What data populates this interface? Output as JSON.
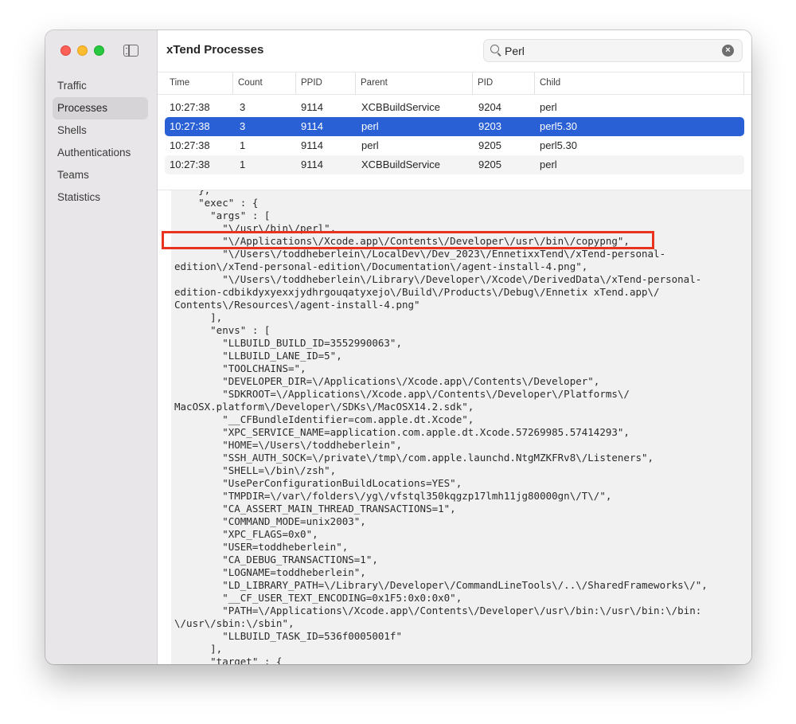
{
  "window": {
    "title": "xTend Processes"
  },
  "sidebar": {
    "items": [
      {
        "label": "Traffic",
        "selected": false
      },
      {
        "label": "Processes",
        "selected": true
      },
      {
        "label": "Shells",
        "selected": false
      },
      {
        "label": "Authentications",
        "selected": false
      },
      {
        "label": "Teams",
        "selected": false
      },
      {
        "label": "Statistics",
        "selected": false
      }
    ]
  },
  "search": {
    "value": "Perl",
    "placeholder": "Search"
  },
  "table": {
    "columns": [
      "Time",
      "Count",
      "PPID",
      "Parent",
      "PID",
      "Child"
    ],
    "rows": [
      {
        "time": "10:27:38",
        "count": "3",
        "ppid": "9114",
        "parent": "XCBBuildService",
        "pid": "9204",
        "child": "perl"
      },
      {
        "time": "10:27:38",
        "count": "3",
        "ppid": "9114",
        "parent": "perl",
        "pid": "9203",
        "child": "perl5.30"
      },
      {
        "time": "10:27:38",
        "count": "1",
        "ppid": "9114",
        "parent": "perl",
        "pid": "9205",
        "child": "perl5.30"
      },
      {
        "time": "10:27:38",
        "count": "1",
        "ppid": "9114",
        "parent": "XCBBuildService",
        "pid": "9205",
        "child": "perl"
      }
    ],
    "selected_row": 1
  },
  "detail": {
    "lines": [
      "    },",
      "    \"exec\" : {",
      "      \"args\" : [",
      "        \"\\/usr\\/bin\\/perl\",",
      "        \"\\/Applications\\/Xcode.app\\/Contents\\/Developer\\/usr\\/bin\\/copypng\",",
      "        \"\\/Users\\/toddheberlein\\/LocalDev\\/Dev_2023\\/EnnetixxTend\\/xTend-personal-",
      "edition\\/xTend-personal-edition\\/Documentation\\/agent-install-4.png\",",
      "        \"\\/Users\\/toddheberlein\\/Library\\/Developer\\/Xcode\\/DerivedData\\/xTend-personal-",
      "edition-cdbikdyxyexxjydhrgouqatyxejo\\/Build\\/Products\\/Debug\\/Ennetix xTend.app\\/",
      "Contents\\/Resources\\/agent-install-4.png\"",
      "      ],",
      "      \"envs\" : [",
      "        \"LLBUILD_BUILD_ID=3552990063\",",
      "        \"LLBUILD_LANE_ID=5\",",
      "        \"TOOLCHAINS=\",",
      "        \"DEVELOPER_DIR=\\/Applications\\/Xcode.app\\/Contents\\/Developer\",",
      "        \"SDKROOT=\\/Applications\\/Xcode.app\\/Contents\\/Developer\\/Platforms\\/",
      "MacOSX.platform\\/Developer\\/SDKs\\/MacOSX14.2.sdk\",",
      "        \"__CFBundleIdentifier=com.apple.dt.Xcode\",",
      "        \"XPC_SERVICE_NAME=application.com.apple.dt.Xcode.57269985.57414293\",",
      "        \"HOME=\\/Users\\/toddheberlein\",",
      "        \"SSH_AUTH_SOCK=\\/private\\/tmp\\/com.apple.launchd.NtgMZKFRv8\\/Listeners\",",
      "        \"SHELL=\\/bin\\/zsh\",",
      "        \"UsePerConfigurationBuildLocations=YES\",",
      "        \"TMPDIR=\\/var\\/folders\\/yg\\/vfstql350kqgzp17lmh11jg80000gn\\/T\\/\",",
      "        \"CA_ASSERT_MAIN_THREAD_TRANSACTIONS=1\",",
      "        \"COMMAND_MODE=unix2003\",",
      "        \"XPC_FLAGS=0x0\",",
      "        \"USER=toddheberlein\",",
      "        \"CA_DEBUG_TRANSACTIONS=1\",",
      "        \"LOGNAME=toddheberlein\",",
      "        \"LD_LIBRARY_PATH=\\/Library\\/Developer\\/CommandLineTools\\/..\\/SharedFrameworks\\/\",",
      "        \"__CF_USER_TEXT_ENCODING=0x1F5:0x0:0x0\",",
      "        \"PATH=\\/Applications\\/Xcode.app\\/Contents\\/Developer\\/usr\\/bin:\\/usr\\/bin:\\/bin:",
      "\\/usr\\/sbin:\\/sbin\",",
      "        \"LLBUILD_TASK_ID=536f0005001f\"",
      "      ],",
      "      \"target\" : {"
    ]
  },
  "colors": {
    "selection": "#2a60d6",
    "highlight_box": "#e8331f"
  }
}
